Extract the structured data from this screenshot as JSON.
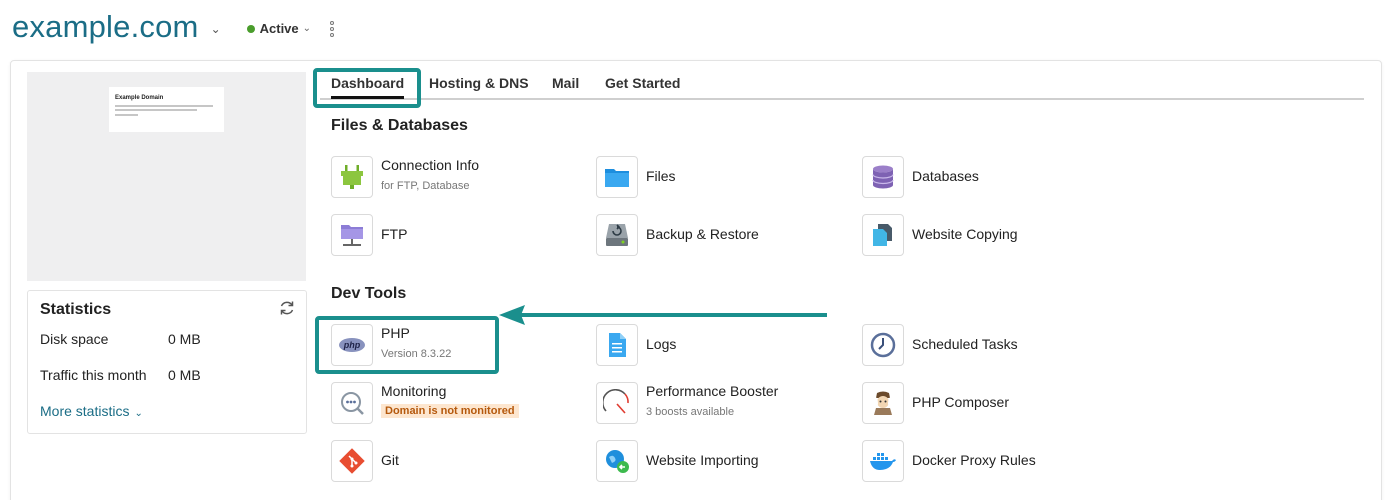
{
  "header": {
    "domain": "example.com",
    "status": "Active"
  },
  "preview": {
    "title": "Example Domain"
  },
  "statistics": {
    "title": "Statistics",
    "rows": [
      {
        "label": "Disk space",
        "value": "0 MB"
      },
      {
        "label": "Traffic this month",
        "value": "0 MB"
      }
    ],
    "more_label": "More statistics"
  },
  "tabs": [
    "Dashboard",
    "Hosting & DNS",
    "Mail",
    "Get Started"
  ],
  "active_tab": "Dashboard",
  "sections": {
    "files_databases": "Files & Databases",
    "dev_tools": "Dev Tools"
  },
  "tools": {
    "connection_info": {
      "label": "Connection Info",
      "sub": "for FTP, Database"
    },
    "files": {
      "label": "Files"
    },
    "databases": {
      "label": "Databases"
    },
    "ftp": {
      "label": "FTP"
    },
    "backup": {
      "label": "Backup & Restore"
    },
    "website_copying": {
      "label": "Website Copying"
    },
    "php": {
      "label": "PHP",
      "sub": "Version 8.3.22"
    },
    "logs": {
      "label": "Logs"
    },
    "scheduled_tasks": {
      "label": "Scheduled Tasks"
    },
    "monitoring": {
      "label": "Monitoring",
      "warning": "Domain is not monitored"
    },
    "performance_booster": {
      "label": "Performance Booster",
      "sub": "3 boosts available"
    },
    "php_composer": {
      "label": "PHP Composer"
    },
    "git": {
      "label": "Git"
    },
    "website_importing": {
      "label": "Website Importing"
    },
    "docker_proxy": {
      "label": "Docker Proxy Rules"
    }
  },
  "icons": {
    "php_badge": "php"
  },
  "colors": {
    "accent": "#1b6d86",
    "highlight": "#1a8f8d",
    "status_active": "#4a9d2c",
    "warning_bg": "#fde6cf",
    "warning_text": "#b5590d"
  }
}
